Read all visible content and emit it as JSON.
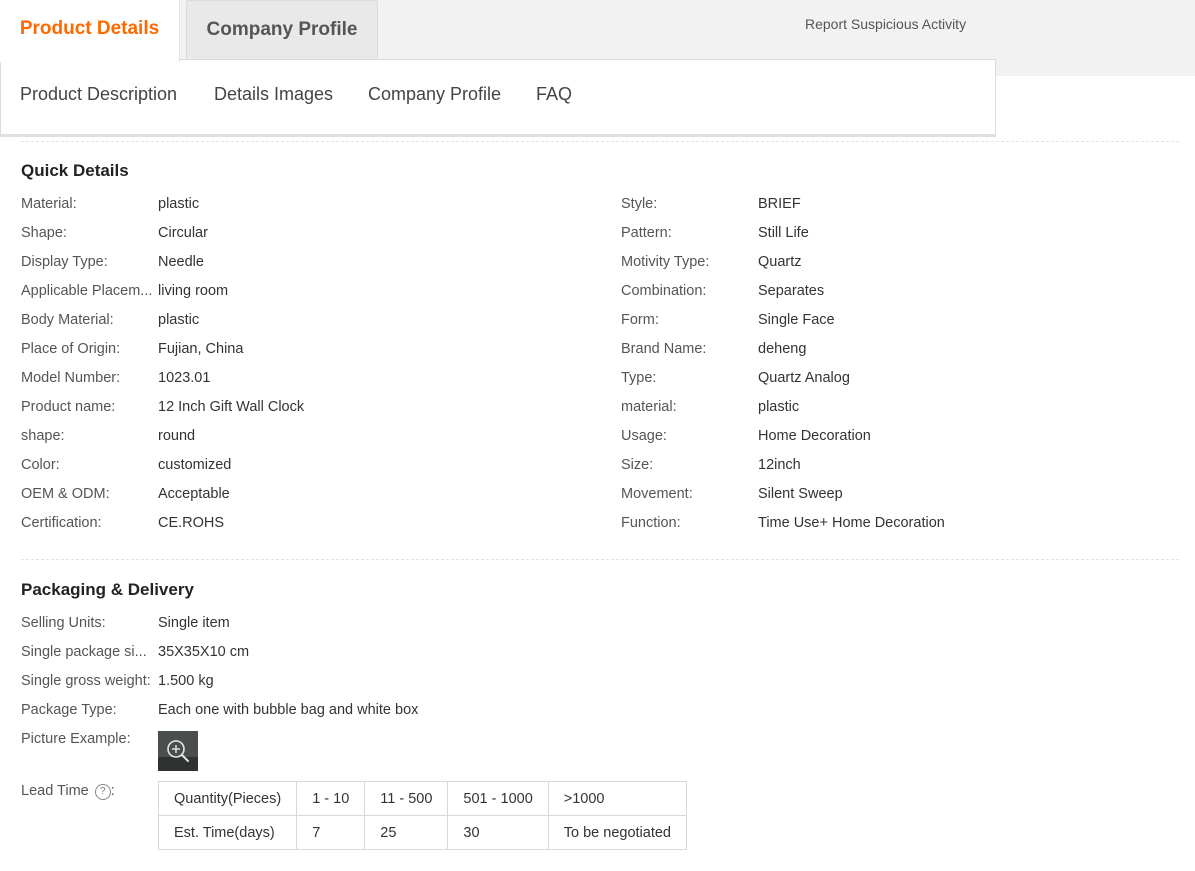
{
  "tabs": {
    "active": "Product Details",
    "inactive": "Company Profile"
  },
  "report_link": "Report Suspicious Activity",
  "subnav": [
    "Product Description",
    "Details Images",
    "Company Profile",
    "FAQ"
  ],
  "quick_details": {
    "title": "Quick Details",
    "left": [
      {
        "label": "Material:",
        "value": "plastic"
      },
      {
        "label": "Shape:",
        "value": "Circular"
      },
      {
        "label": "Display Type:",
        "value": "Needle"
      },
      {
        "label": "Applicable Placem...",
        "value": "living room"
      },
      {
        "label": "Body Material:",
        "value": "plastic"
      },
      {
        "label": "Place of Origin:",
        "value": "Fujian, China"
      },
      {
        "label": "Model Number:",
        "value": "1023.01"
      },
      {
        "label": "Product name:",
        "value": "12 Inch Gift Wall Clock"
      },
      {
        "label": "shape:",
        "value": "round"
      },
      {
        "label": "Color:",
        "value": "customized"
      },
      {
        "label": "OEM & ODM:",
        "value": "Acceptable"
      },
      {
        "label": "Certification:",
        "value": "CE.ROHS"
      }
    ],
    "right": [
      {
        "label": "Style:",
        "value": "BRIEF"
      },
      {
        "label": "Pattern:",
        "value": "Still Life"
      },
      {
        "label": "Motivity Type:",
        "value": "Quartz"
      },
      {
        "label": "Combination:",
        "value": "Separates"
      },
      {
        "label": "Form:",
        "value": "Single Face"
      },
      {
        "label": "Brand Name:",
        "value": "deheng"
      },
      {
        "label": "Type:",
        "value": "Quartz Analog"
      },
      {
        "label": "material:",
        "value": "plastic"
      },
      {
        "label": "Usage:",
        "value": "Home Decoration"
      },
      {
        "label": "Size:",
        "value": "12inch"
      },
      {
        "label": "Movement:",
        "value": "Silent Sweep"
      },
      {
        "label": "Function:",
        "value": "Time Use+ Home Decoration"
      }
    ]
  },
  "packaging": {
    "title": "Packaging & Delivery",
    "rows": [
      {
        "label": "Selling Units:",
        "value": "Single item"
      },
      {
        "label": "Single package si...",
        "value": "35X35X10 cm"
      },
      {
        "label": "Single gross weight:",
        "value": "1.500 kg"
      },
      {
        "label": "Package Type:",
        "value": "Each one with bubble bag and white box"
      }
    ],
    "picture_label": "Picture Example:",
    "lead_time_label": "Lead Time",
    "lead_time_colon": ":",
    "help_glyph": "?",
    "lead_table": [
      [
        "Quantity(Pieces)",
        "1 - 10",
        "11 - 500",
        "501 - 1000",
        ">1000"
      ],
      [
        "Est. Time(days)",
        "7",
        "25",
        "30",
        "To be negotiated"
      ]
    ]
  },
  "colors": {
    "accent": "#ff6a00",
    "tab_band": "#f2f2f2"
  }
}
